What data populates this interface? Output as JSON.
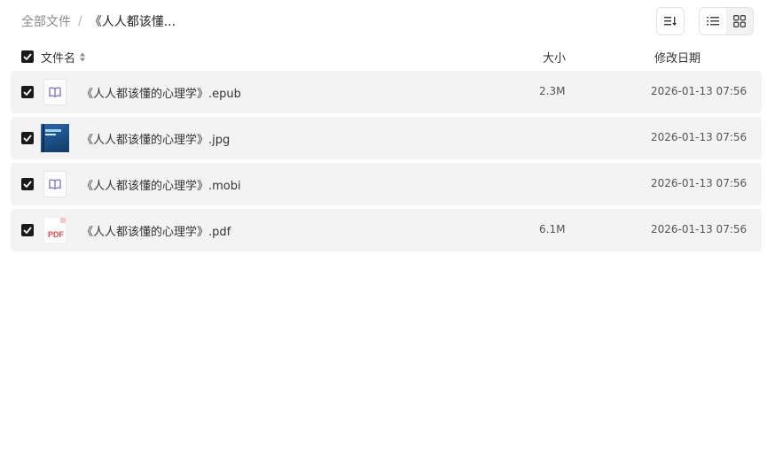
{
  "breadcrumb": {
    "root": "全部文件",
    "separator": "/",
    "current": "《人人都该懂..."
  },
  "toolbar": {
    "sort_icon": "sort-descending-icon",
    "view_list_icon": "list-view-icon",
    "view_grid_icon": "grid-view-icon",
    "active_view": "grid"
  },
  "table": {
    "headers": {
      "name": "文件名",
      "size": "大小",
      "date": "修改日期"
    },
    "select_all_checked": true,
    "rows": [
      {
        "name": "《人人都该懂的心理学》.epub",
        "size": "2.3M",
        "date": "2026-01-13 07:56",
        "icon": "ebook-icon",
        "checked": true
      },
      {
        "name": "《人人都该懂的心理学》.jpg",
        "size": "",
        "date": "2026-01-13 07:56",
        "icon": "image-thumbnail",
        "checked": true
      },
      {
        "name": "《人人都该懂的心理学》.mobi",
        "size": "",
        "date": "2026-01-13 07:56",
        "icon": "ebook-icon",
        "checked": true
      },
      {
        "name": "《人人都该懂的心理学》.pdf",
        "size": "6.1M",
        "date": "2026-01-13 07:56",
        "icon": "pdf-icon",
        "checked": true
      }
    ]
  },
  "colors": {
    "row_bg": "#f3f3f3",
    "checkbox": "#1a1a1a",
    "ebook_accent": "#7b6fd6",
    "pdf_accent": "#e5484d"
  }
}
